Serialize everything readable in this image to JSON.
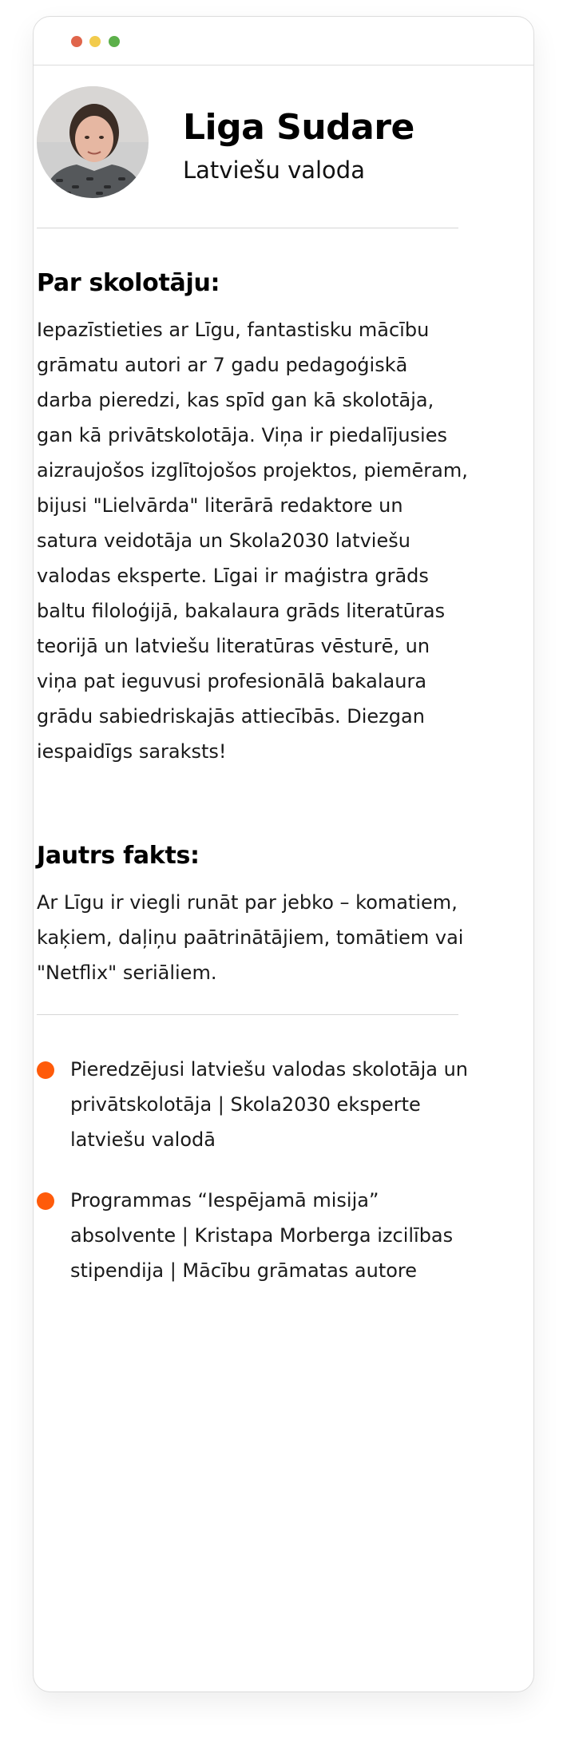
{
  "colors": {
    "dot_red": "#e0654b",
    "dot_yellow": "#f2cb4c",
    "dot_green": "#5cb04a",
    "bullet": "#ff5b0a"
  },
  "teacher": {
    "name": "Liga Sudare",
    "subject": "Latviešu valoda"
  },
  "about": {
    "title": "Par skolotāju:",
    "text": "Iepazīstieties ar Līgu, fantastisku mācību grāmatu autori ar 7 gadu pedagoģiskā darba pieredzi, kas spīd gan kā skolotāja, gan kā privātskolotāja. Viņa ir piedalījusies aizraujošos izglītojošos projektos, piemēram, bijusi \"Lielvārda\" literārā redaktore un satura veidotāja un Skola2030 latviešu valodas eksperte. Līgai ir maģistra grāds baltu filoloģijā, bakalaura grāds literatūras teorijā un latviešu literatūras vēsturē, un viņa pat ieguvusi profesionālā bakalaura grādu sabiedriskajās attiecībās. Diezgan iespaidīgs saraksts!"
  },
  "fun_fact": {
    "title": "Jautrs fakts:",
    "text": "Ar Līgu ir viegli runāt par jebko – komatiem, kaķiem, daļiņu paātrinātājiem, tomātiem vai \"Netflix\" seriāliem."
  },
  "highlights": [
    "Pieredzējusi latviešu valodas skolotāja un privātskolotāja | Skola2030 eksperte latviešu valodā",
    "Programmas “Iespējamā misija” absolvente | Kristapa Morberga izcilības stipendija | Mācību grāmatas autore"
  ]
}
